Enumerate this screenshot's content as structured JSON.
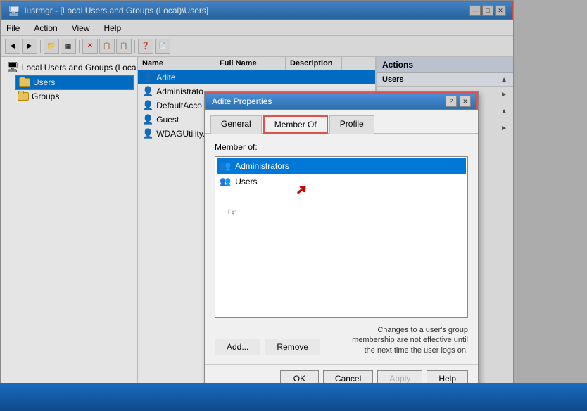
{
  "titlebar": {
    "title": "lusrmgr - [Local Users and Groups (Local)\\Users]",
    "min": "—",
    "max": "□",
    "close": "✕"
  },
  "menu": {
    "items": [
      "File",
      "Action",
      "View",
      "Help"
    ]
  },
  "toolbar": {
    "buttons": [
      "←",
      "→",
      "📁",
      "□",
      "✕",
      "📋",
      "📋",
      "❓",
      "📄"
    ]
  },
  "tree": {
    "root": "Local Users and Groups (Local)",
    "children": [
      {
        "label": "Users",
        "selected": true
      },
      {
        "label": "Groups",
        "selected": false
      }
    ]
  },
  "list": {
    "columns": [
      "Name",
      "Full Name",
      "Description"
    ],
    "rows": [
      {
        "name": "Adite",
        "fullname": "",
        "desc": "",
        "selected": true
      },
      {
        "name": "Administrato...",
        "fullname": "",
        "desc": ""
      },
      {
        "name": "DefaultAcco...",
        "fullname": "",
        "desc": ""
      },
      {
        "name": "Guest",
        "fullname": "",
        "desc": ""
      },
      {
        "name": "WDAGUtility...",
        "fullname": "",
        "desc": ""
      }
    ]
  },
  "actions": {
    "header": "Actions",
    "sections": [
      {
        "label": "Users",
        "arrow": "▲"
      },
      {
        "label": "",
        "arrow": "►"
      },
      {
        "label": "",
        "arrow": "▲"
      },
      {
        "label": "",
        "arrow": "►"
      }
    ]
  },
  "dialog": {
    "title": "Adite Properties",
    "help": "?",
    "close": "✕",
    "tabs": [
      "General",
      "Member Of",
      "Profile"
    ],
    "active_tab": "Member Of",
    "member_of_label": "Member of:",
    "members": [
      {
        "name": "Administrators",
        "selected": true
      },
      {
        "name": "Users",
        "selected": false
      }
    ],
    "note": "Changes to a user's group membership are not effective until the next time the user logs on.",
    "buttons": {
      "add": "Add...",
      "remove": "Remove",
      "ok": "OK",
      "cancel": "Cancel",
      "apply": "Apply",
      "help": "Help"
    }
  }
}
